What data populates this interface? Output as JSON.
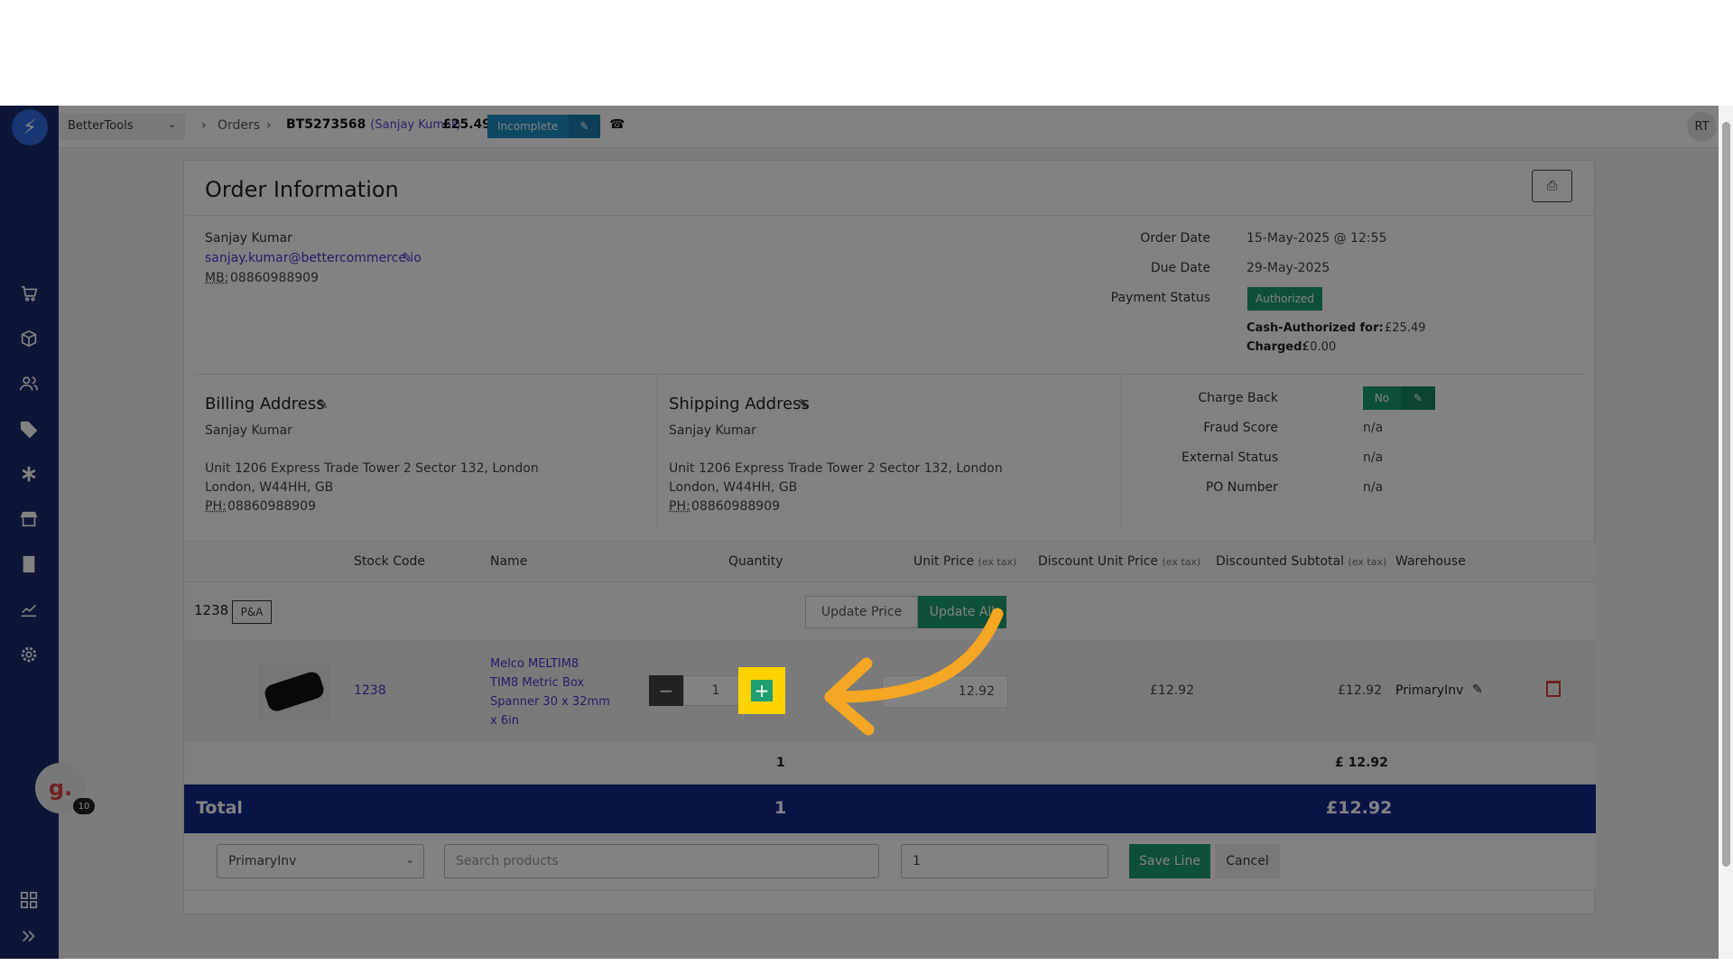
{
  "header": {
    "store": "BetterTools",
    "breadcrumb_sep": "›",
    "breadcrumb_orders": "Orders",
    "order_number": "BT5273568",
    "order_customer": "(Sanjay Kumar)",
    "order_amount": "£25.49",
    "status": "Incomplete",
    "avatar_initials": "RT"
  },
  "order": {
    "title": "Order Information",
    "customer_name": "Sanjay Kumar",
    "customer_email": "sanjay.kumar@bettercommerce.io",
    "mobile_label": "MB:",
    "mobile": "08860988909",
    "order_date_label": "Order Date",
    "order_date": "15-May-2025 @ 12:55",
    "due_date_label": "Due Date",
    "due_date": "29-May-2025",
    "payment_status_label": "Payment Status",
    "payment_status": "Authorized",
    "cash_auth_label": "Cash-Authorized for:",
    "cash_auth": "£25.49",
    "charged_label": "Charged:",
    "charged": "£0.00"
  },
  "billing": {
    "title": "Billing Address",
    "name": "Sanjay Kumar",
    "line1": "Unit 1206 Express Trade Tower 2 Sector 132, London",
    "line2": "London, W44HH, GB",
    "phone_label": "PH:",
    "phone": "08860988909"
  },
  "shipping": {
    "title": "Shipping Address",
    "name": "Sanjay Kumar",
    "line1": "Unit 1206 Express Trade Tower 2 Sector 132, London",
    "line2": "London, W44HH, GB",
    "phone_label": "PH:",
    "phone": "08860988909"
  },
  "extra": {
    "charge_back_label": "Charge Back",
    "charge_back": "No",
    "fraud_label": "Fraud Score",
    "fraud": "n/a",
    "external_label": "External Status",
    "external": "n/a",
    "po_label": "PO Number",
    "po": "n/a"
  },
  "table": {
    "headers": {
      "stock_code": "Stock Code",
      "name": "Name",
      "quantity": "Quantity",
      "unit_price": "Unit Price",
      "discount_unit_price": "Discount Unit Price",
      "discounted_subtotal": "Discounted Subtotal",
      "ex_tax": "(ex tax)",
      "warehouse": "Warehouse"
    },
    "group_code": "1238",
    "group_badge": "P&A",
    "update_price": "Update Price",
    "update_all": "Update All",
    "item": {
      "stock_code": "1238",
      "name_lines": [
        "Melco MELTIM8",
        "TIM8 Metric Box",
        "Spanner 30 x 32mm",
        "x 6in"
      ],
      "quantity": "1",
      "unit_price": "12.92",
      "discount_unit_price": "£12.92",
      "subtotal": "£12.92",
      "warehouse": "PrimaryInv"
    },
    "group_qty": "1",
    "group_subtotal": "£ 12.92",
    "total_label": "Total",
    "total_qty": "1",
    "total_amount": "£12.92"
  },
  "add_line": {
    "warehouse": "PrimaryInv",
    "search_placeholder": "Search products",
    "quantity": "1",
    "save": "Save Line",
    "cancel": "Cancel"
  },
  "guide": {
    "logo": "g.",
    "count": "10"
  },
  "colors": {
    "sidebar": "#1d2b6e",
    "accent_green": "#1e9e6e",
    "total_bar": "#13298b",
    "status_blue": "#1f8fc7",
    "highlight": "#ffd200",
    "arrow": "#f5a623"
  }
}
